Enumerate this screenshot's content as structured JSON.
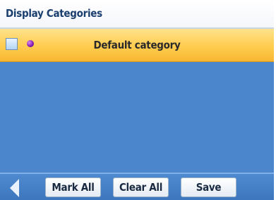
{
  "header": {
    "title": "Display Categories"
  },
  "categories": [
    {
      "label": "Default category",
      "checked": false,
      "color": "#8a1fb5",
      "selected": true
    }
  ],
  "toolbar": {
    "back_icon": "back-arrow-icon",
    "mark_all_label": "Mark All",
    "clear_all_label": "Clear All",
    "save_label": "Save"
  },
  "colors": {
    "accent_blue": "#4b86cc",
    "highlight": "#ffcc4e",
    "title_text": "#1a3e6e"
  }
}
